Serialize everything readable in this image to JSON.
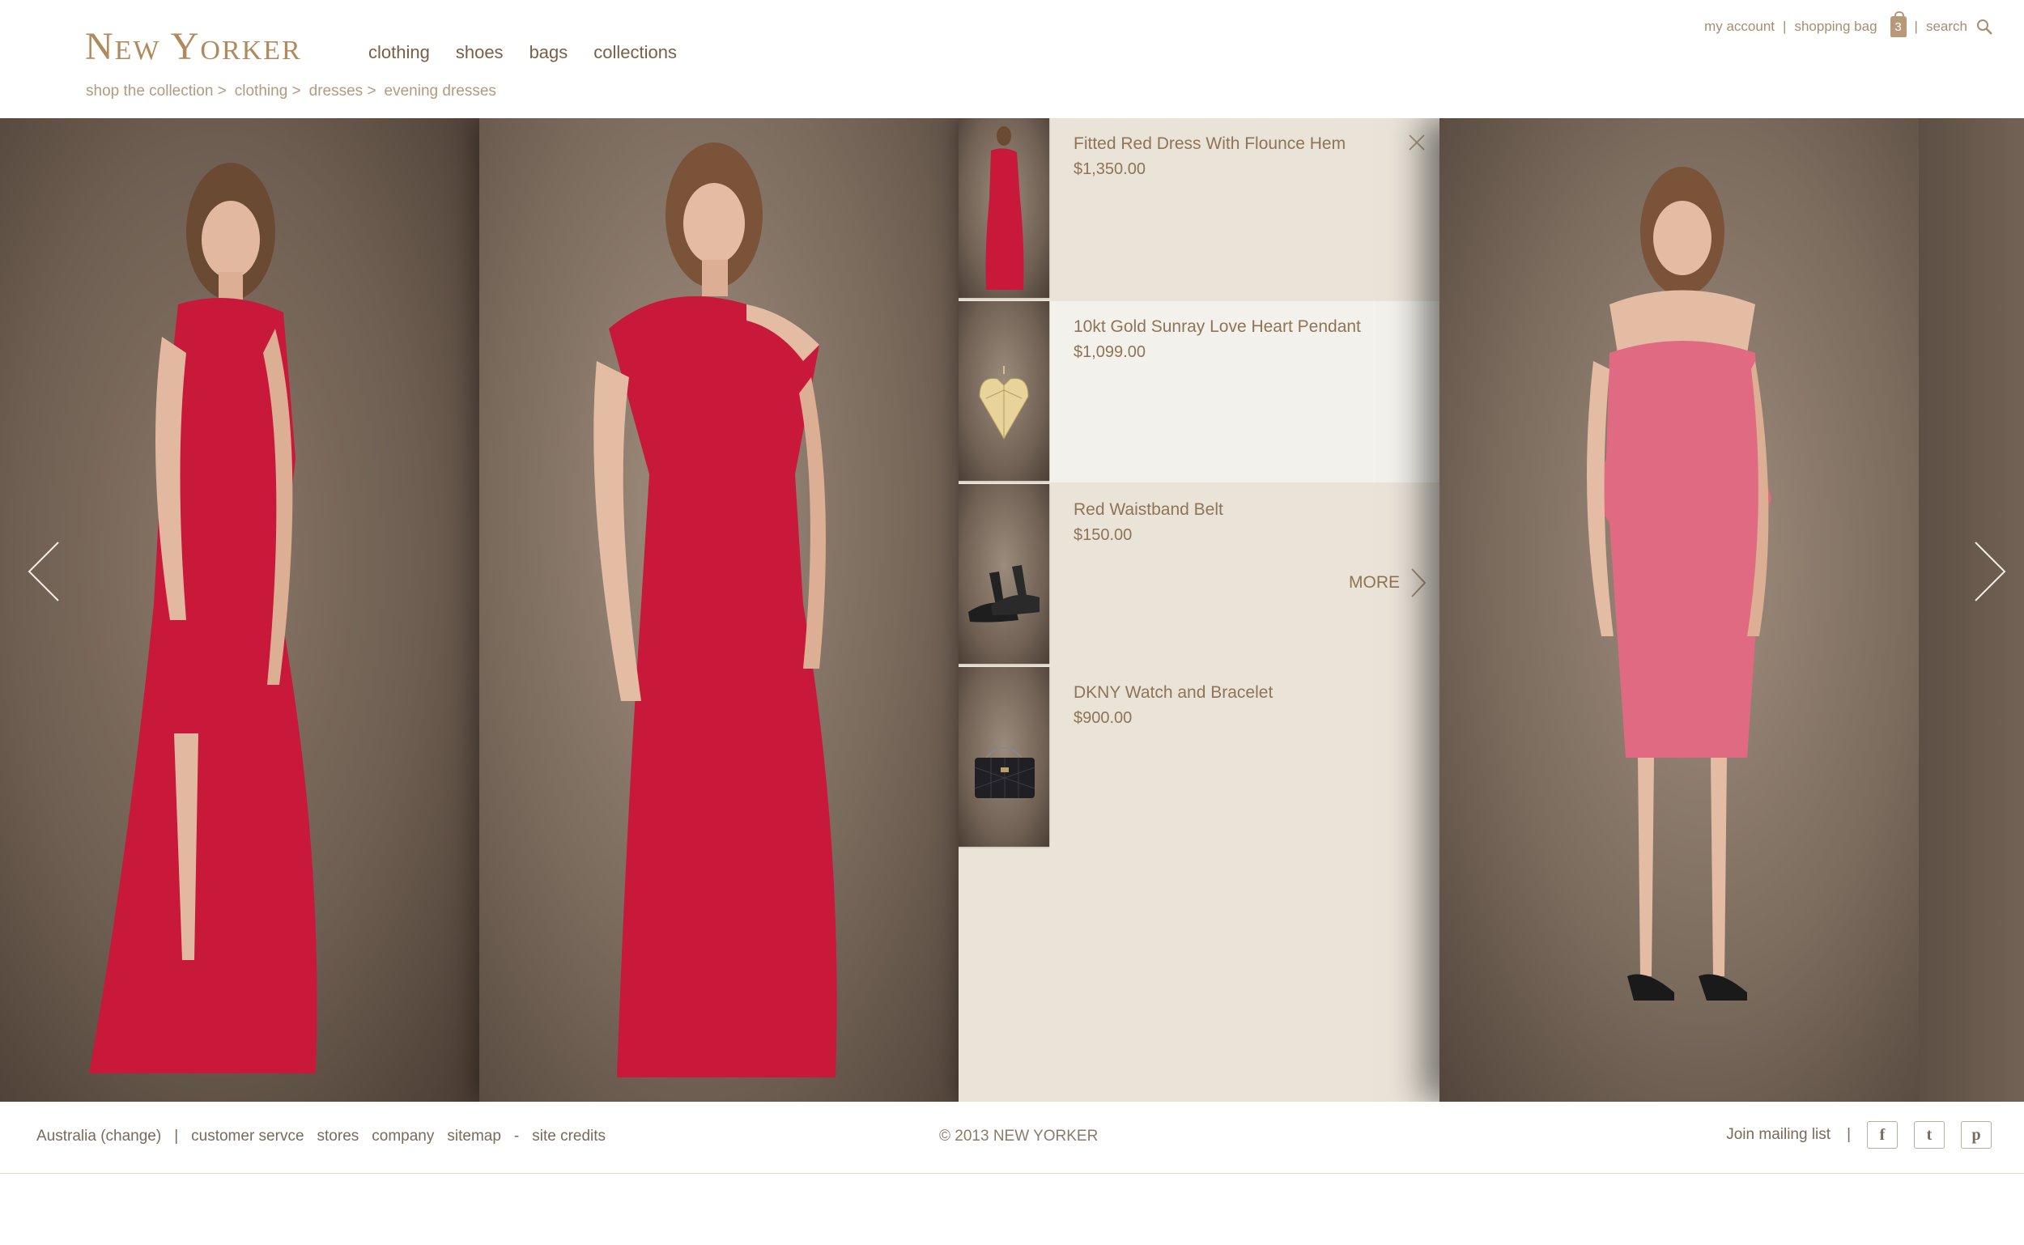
{
  "header": {
    "logo": "New Yorker",
    "nav": [
      "clothing",
      "shoes",
      "bags",
      "collections"
    ],
    "breadcrumb": [
      "shop the collection >",
      "clothing >",
      "dresses >",
      "evening dresses"
    ],
    "util": {
      "my_account": "my account",
      "separator": "|",
      "shopping_bag": "shopping bag",
      "bag_count": "3",
      "search": "search"
    }
  },
  "panel": {
    "items": [
      {
        "name": "Fitted Red Dress With Flounce Hem",
        "price": "$1,350.00",
        "thumb_icon": "red-dress-icon"
      },
      {
        "name": "10kt Gold Sunray Love Heart Pendant",
        "price": "$1,099.00",
        "thumb_icon": "heart-pendant-icon"
      },
      {
        "name": "Red Waistband Belt",
        "price": "$150.00",
        "thumb_icon": "sandals-icon"
      },
      {
        "name": "DKNY Watch and Bracelet",
        "price": "$900.00",
        "thumb_icon": "handbag-icon"
      }
    ],
    "more_label": "MORE"
  },
  "footer": {
    "links": [
      "Australia (change)",
      "|",
      "customer servce",
      "stores",
      "company",
      "sitemap",
      "-",
      "site credits"
    ],
    "copyright": "© 2013 NEW YORKER",
    "mailing": "Join mailing list",
    "separator": "|",
    "social": [
      "f",
      "t",
      "p"
    ]
  },
  "colors": {
    "brand": "#b08a5c",
    "panel": "#e9e3d8",
    "dress_red": "#c8193a",
    "dress_pink": "#e06a82"
  }
}
